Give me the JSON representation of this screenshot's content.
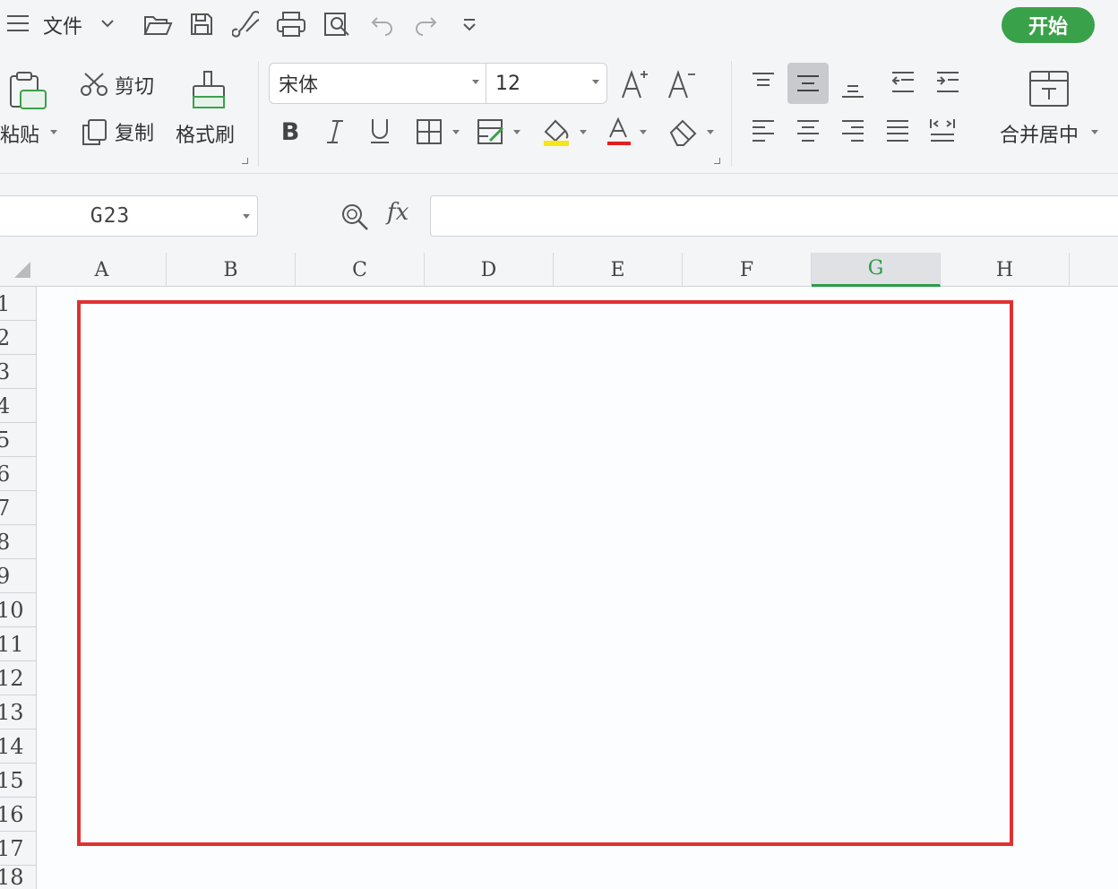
{
  "quickbar": {
    "file_label": "文件",
    "start_button": "开始",
    "icons": [
      "menu-icon",
      "chevron-down-icon",
      "open-folder-icon",
      "save-icon",
      "brush-icon",
      "print-icon",
      "print-preview-icon",
      "undo-icon",
      "redo-icon",
      "customize-dropdown-icon"
    ]
  },
  "ribbon": {
    "clipboard": {
      "paste": "粘贴",
      "cut": "剪切",
      "copy": "复制",
      "format_painter": "格式刷"
    },
    "font": {
      "name": "宋体",
      "size": "12"
    },
    "alignment": {
      "merge_center": "合并居中"
    },
    "colors": {
      "highlight": "#f5e61a",
      "font_color": "#e02020",
      "accent": "#3aa14b"
    }
  },
  "formula_bar": {
    "cell_ref": "G23",
    "fx": "fx",
    "value": ""
  },
  "grid": {
    "columns": [
      "A",
      "B",
      "C",
      "D",
      "E",
      "F",
      "G",
      "H"
    ],
    "active_column": "G",
    "rows": [
      "1",
      "2",
      "3",
      "4",
      "5",
      "6",
      "7",
      "8",
      "9",
      "10",
      "11",
      "12",
      "13",
      "14",
      "15",
      "16",
      "17",
      "18"
    ],
    "highlight_color": "#e03131"
  }
}
